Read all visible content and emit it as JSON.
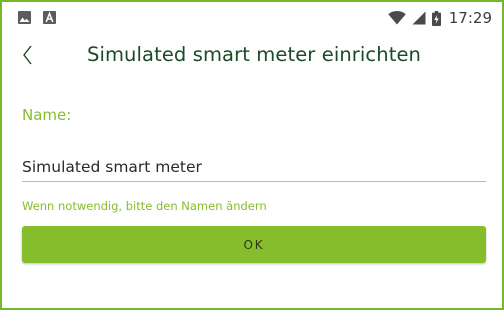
{
  "status_bar": {
    "left_icons": [
      "image-icon",
      "a-app-icon"
    ],
    "right_icons": [
      "wifi-icon",
      "cell-signal-icon",
      "battery-charging-icon"
    ],
    "time": "17:29"
  },
  "header": {
    "back_icon": "chevron-left-icon",
    "title": "Simulated smart meter einrichten"
  },
  "form": {
    "name_label": "Name:",
    "name_value": "Simulated smart meter",
    "hint": "Wenn notwendig, bitte den Namen ändern"
  },
  "ok_button": {
    "label": "OK"
  },
  "colors": {
    "accent": "#86bd2c",
    "frame": "#76b82a",
    "title": "#1a4a28"
  }
}
